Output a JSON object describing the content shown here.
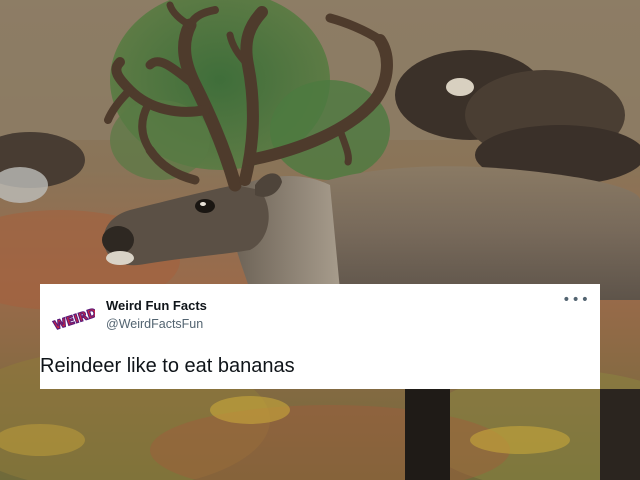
{
  "tweet": {
    "author_name": "Weird Fun Facts",
    "author_handle": "@WeirdFactsFun",
    "text": "Reindeer like to eat bananas",
    "avatar_text": "WEIRD",
    "more_icon": "more-horizontal-icon"
  },
  "colors": {
    "card_background": "#ffffff",
    "name_color": "#0f1419",
    "handle_color": "#536471"
  }
}
